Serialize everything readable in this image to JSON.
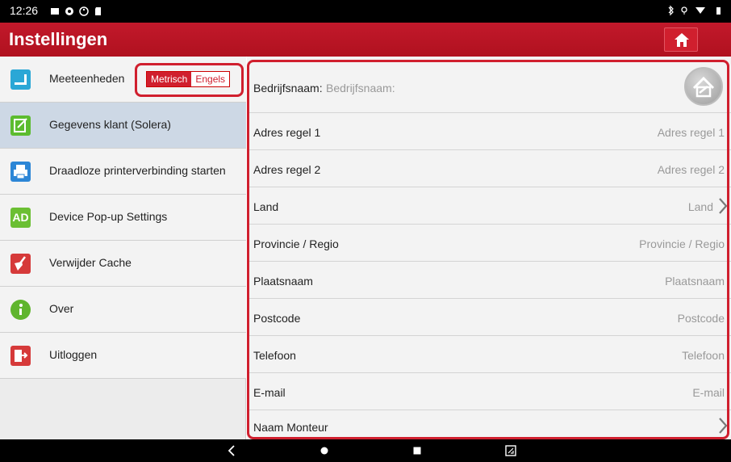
{
  "status_bar": {
    "time": "12:26",
    "icons": [
      "message-icon",
      "shield-icon",
      "accessibility-icon",
      "sd-card-icon"
    ],
    "right_icons": [
      "bluetooth-icon",
      "location-icon",
      "wifi-icon",
      "battery-icon"
    ]
  },
  "header": {
    "title": "Instellingen",
    "home_icon": "home-icon"
  },
  "sidebar": {
    "items": [
      {
        "label": "Meeteenheden",
        "icon": "ruler-icon",
        "icon_color": "#2aa7d6",
        "selected": false
      },
      {
        "label": "Gegevens klant (Solera)",
        "icon": "edit-icon",
        "icon_color": "#5cbc2f",
        "selected": true
      },
      {
        "label": "Draadloze printerverbinding starten",
        "icon": "printer-icon",
        "icon_color": "#2c86d6",
        "selected": false
      },
      {
        "label": "Device Pop-up Settings",
        "icon": "ad-icon",
        "icon_text": "AD",
        "icon_color": "#6bbf33",
        "selected": false
      },
      {
        "label": "Verwijder Cache",
        "icon": "broom-icon",
        "icon_color": "#d63a3a",
        "selected": false
      },
      {
        "label": "Over",
        "icon": "info-icon",
        "icon_color": "#5fb52d",
        "selected": false
      },
      {
        "label": "Uitloggen",
        "icon": "logout-icon",
        "icon_color": "#d63a3a",
        "selected": false
      }
    ],
    "units": {
      "metric": "Metrisch",
      "imperial": "Engels",
      "selected": "Metrisch"
    }
  },
  "form": {
    "company": {
      "label": "Bedrijfsnaam:",
      "placeholder": "Bedrijfsnaam:"
    },
    "fields": [
      {
        "label": "Adres regel 1",
        "placeholder": "Adres regel 1",
        "chevron": false
      },
      {
        "label": "Adres regel 2",
        "placeholder": "Adres regel 2",
        "chevron": false
      },
      {
        "label": "Land",
        "placeholder": "Land",
        "chevron": true
      },
      {
        "label": "Provincie / Regio",
        "placeholder": "Provincie / Regio",
        "chevron": false
      },
      {
        "label": "Plaatsnaam",
        "placeholder": "Plaatsnaam",
        "chevron": false
      },
      {
        "label": "Postcode",
        "placeholder": "Postcode",
        "chevron": false
      },
      {
        "label": "Telefoon",
        "placeholder": "Telefoon",
        "chevron": false
      },
      {
        "label": "E-mail",
        "placeholder": "E-mail",
        "chevron": false
      },
      {
        "label": "Naam Monteur",
        "placeholder": "",
        "chevron": true
      }
    ]
  },
  "nav_bar": {
    "buttons": [
      "back-icon",
      "home-circle-icon",
      "recents-icon",
      "screenshot-icon"
    ]
  },
  "colors": {
    "brand_red": "#c2192b",
    "selected_item": "#cdd8e5",
    "highlight_outline": "#d01f2e"
  }
}
